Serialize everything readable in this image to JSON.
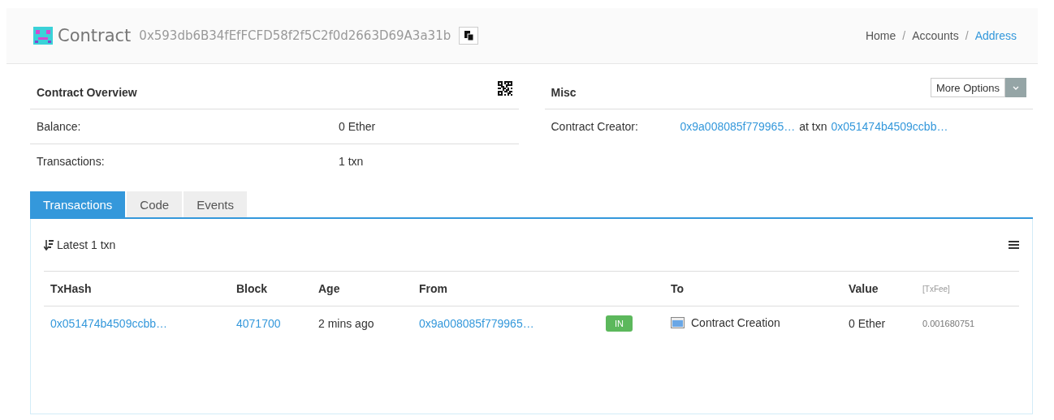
{
  "header": {
    "title": "Contract",
    "address": "0x593db6B34fEfFCFD58f2f5C2f0d2663D69A3a31b",
    "breadcrumbs": [
      {
        "label": "Home",
        "selected": false
      },
      {
        "label": "Accounts",
        "selected": false
      },
      {
        "label": "Address",
        "selected": true
      }
    ],
    "separators": [
      "/",
      "/"
    ]
  },
  "overview": {
    "title": "Contract Overview",
    "rows": [
      {
        "label": "Balance:",
        "value": "0 Ether"
      },
      {
        "label": "Transactions:",
        "value": "1 txn"
      }
    ]
  },
  "misc": {
    "title": "Misc",
    "more_button": "More Options",
    "creator_label": "Contract Creator:",
    "creator": "0x9a008085f779965…",
    "at_txn": "at txn",
    "txn": "0x051474b4509ccbb…"
  },
  "tabs": [
    {
      "label": "Transactions",
      "selected": true
    },
    {
      "label": "Code",
      "selected": false
    },
    {
      "label": "Events",
      "selected": false
    }
  ],
  "summary": "Latest 1 txn",
  "table": {
    "columns": [
      "TxHash",
      "Block",
      "Age",
      "From",
      "",
      "To",
      "Value",
      "[TxFee]"
    ],
    "rows": [
      {
        "txhash": "0x051474b4509ccbb…",
        "block": "4071700",
        "age": "2 mins ago",
        "from": "0x9a008085f779965…",
        "direction": "IN",
        "to": "Contract Creation",
        "value": "0 Ether",
        "fee": "0.001680751"
      }
    ]
  }
}
